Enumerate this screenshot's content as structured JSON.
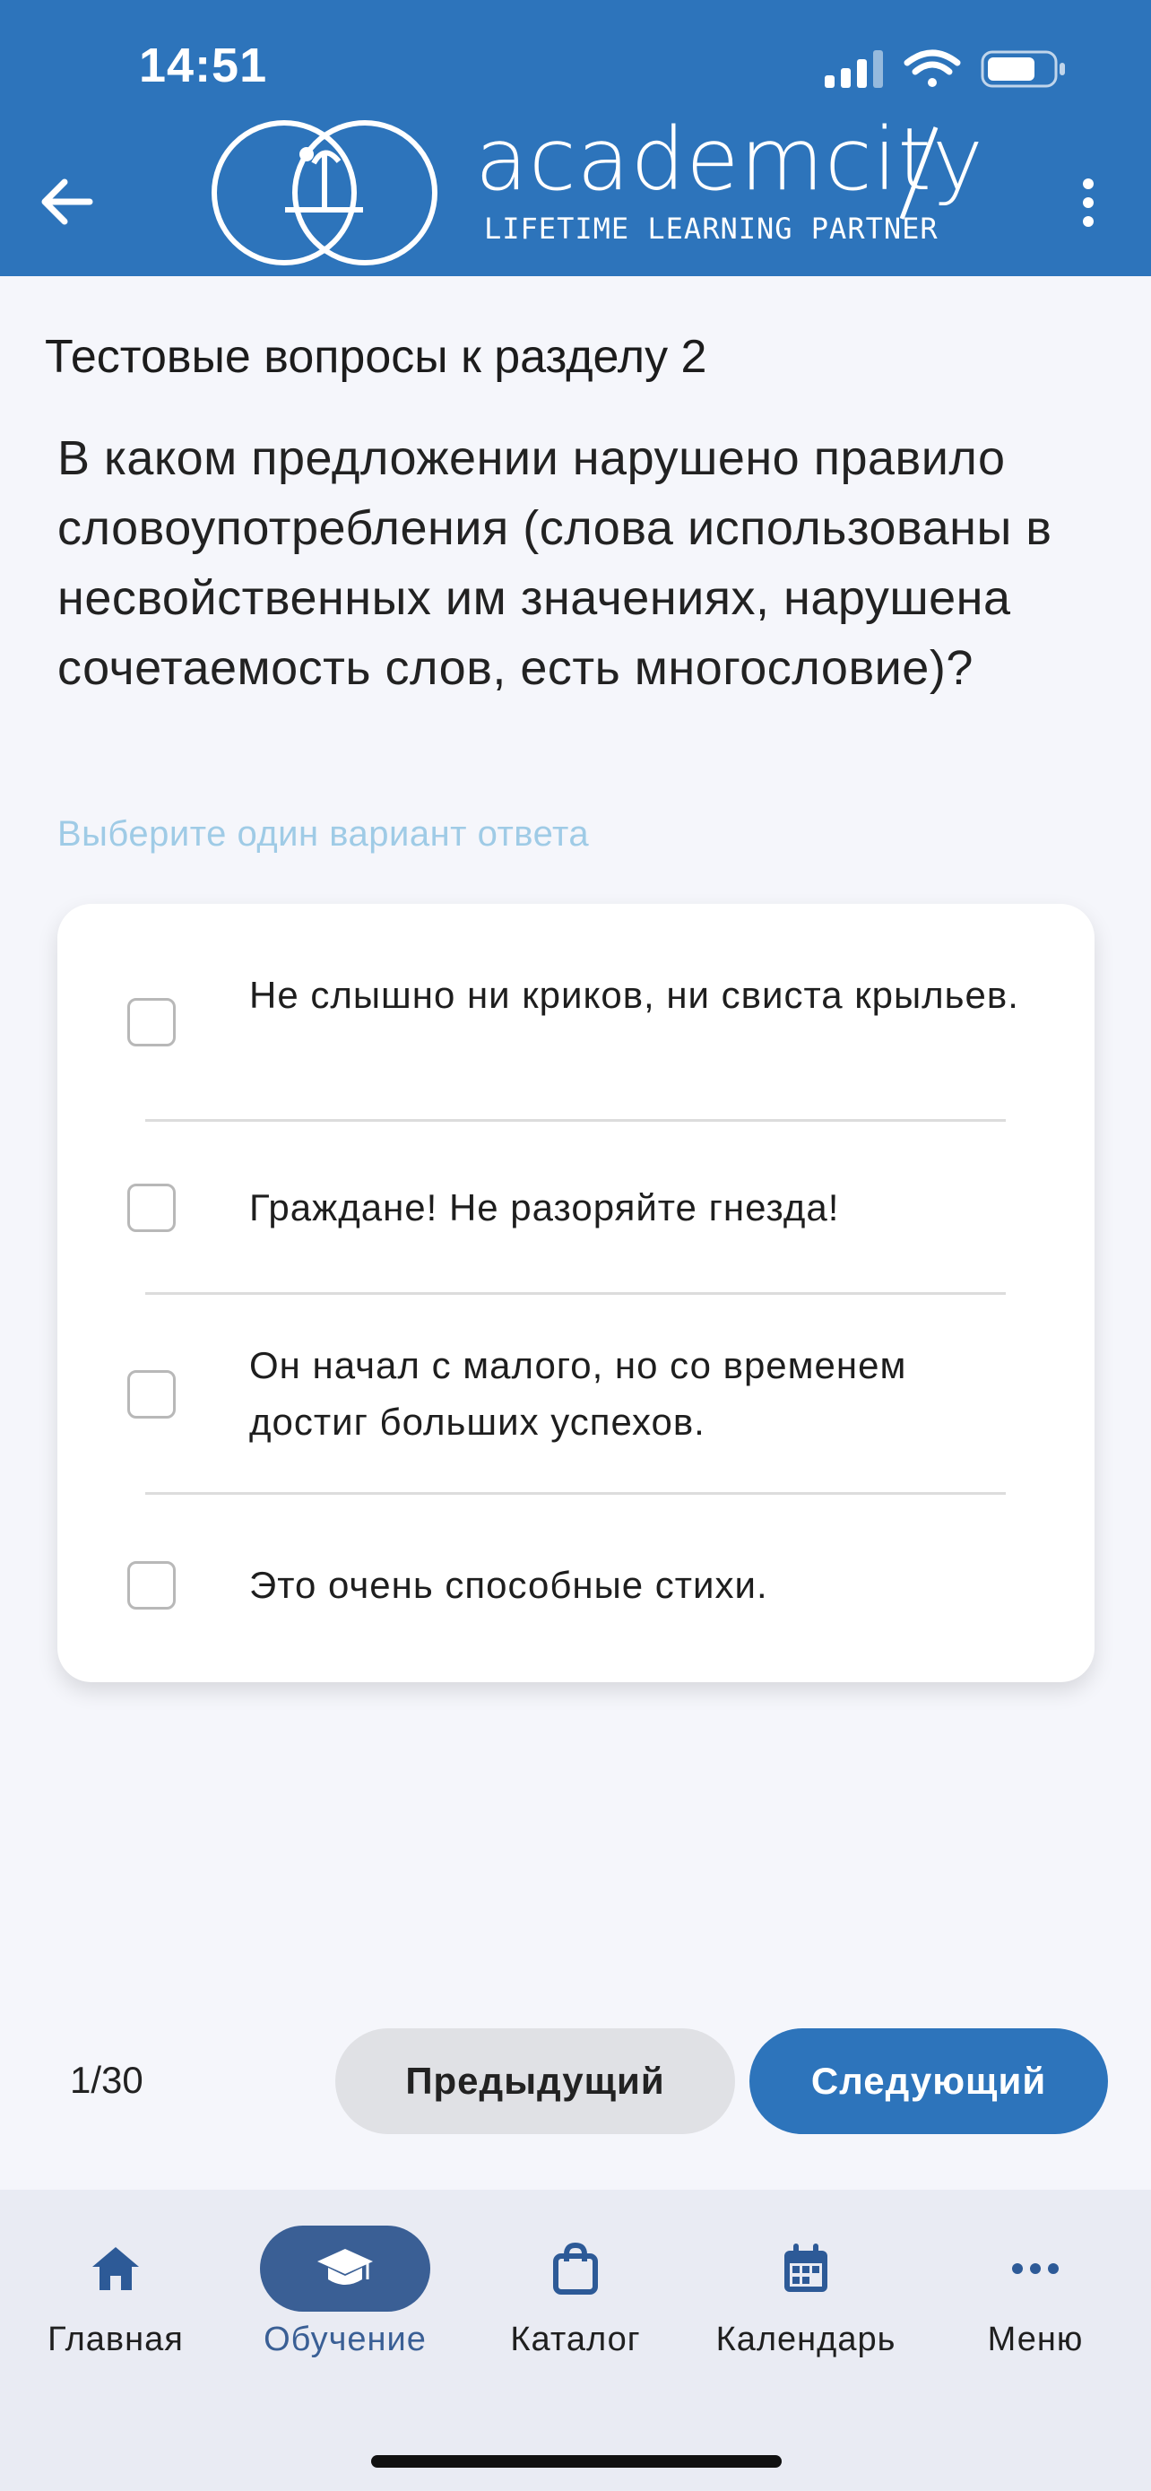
{
  "status_bar": {
    "time": "14:51"
  },
  "header": {
    "brand": "academcity",
    "tagline": "LIFETIME LEARNING PARTNER",
    "colors": {
      "header_bg": "#2d74bb"
    }
  },
  "test": {
    "section_title": "Тестовые вопросы к разделу 2",
    "question": "В каком предложении нарушено правило словоупотребления (слова использованы в несвойственных им значениях, нарушена сочетаемость слов, есть многословие)?",
    "hint": "Выберите один вариант ответа",
    "options": [
      {
        "label": "Не слышно ни криков, ни свиста крыльев.",
        "checked": false
      },
      {
        "label": "Граждане! Не разоряйте гнезда!",
        "checked": false
      },
      {
        "label": "Он начал с малого, но со временем достиг больших успехов.",
        "checked": false
      },
      {
        "label": "Это очень способные стихи.",
        "checked": false
      }
    ]
  },
  "pager": {
    "counter": "1/30",
    "prev_label": "Предыдущий",
    "next_label": "Следующий"
  },
  "bottom_nav": {
    "items": [
      {
        "label": "Главная",
        "icon": "home-icon",
        "active": false
      },
      {
        "label": "Обучение",
        "icon": "graduation-cap-icon",
        "active": true
      },
      {
        "label": "Каталог",
        "icon": "shopping-bag-icon",
        "active": false
      },
      {
        "label": "Календарь",
        "icon": "calendar-icon",
        "active": false
      },
      {
        "label": "Меню",
        "icon": "more-horizontal-icon",
        "active": false
      }
    ]
  }
}
